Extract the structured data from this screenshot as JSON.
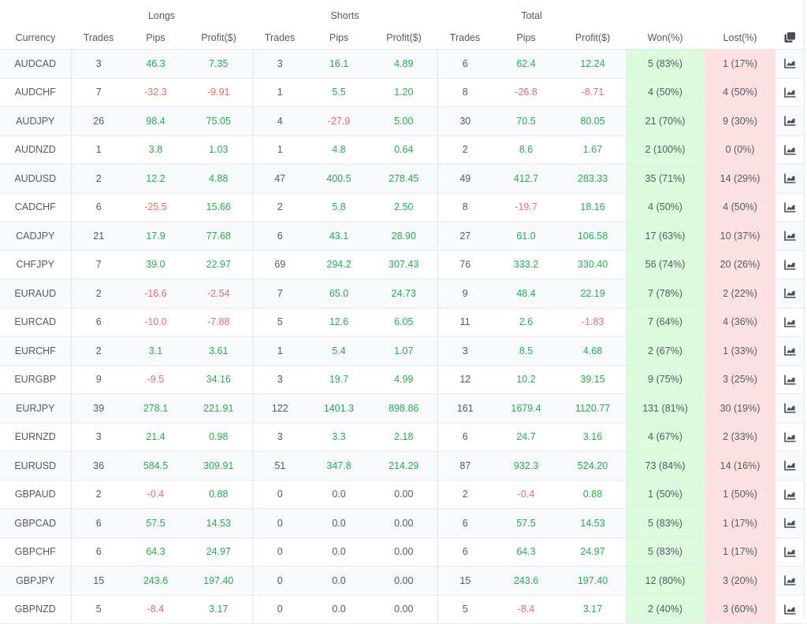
{
  "header": {
    "groups": {
      "longs": "Longs",
      "shorts": "Shorts",
      "total": "Total"
    },
    "columns": {
      "currency": "Currency",
      "long_trades": "Trades",
      "long_pips": "Pips",
      "long_profit": "Profit($)",
      "short_trades": "Trades",
      "short_pips": "Pips",
      "short_profit": "Profit($)",
      "total_trades": "Trades",
      "total_pips": "Pips",
      "total_profit": "Profit($)",
      "won": "Won(%)",
      "lost": "Lost(%)"
    },
    "header_icon": "copy-icon"
  },
  "row_icon": "chart-line-icon",
  "colors": {
    "positive": "#22b14c",
    "negative": "#f0686c",
    "won_bg": "#dcfbdc",
    "lost_bg": "#fde1e2"
  },
  "rows": [
    {
      "currency": "AUDCAD",
      "lt": "3",
      "lp": "46.3",
      "lf": "7.35",
      "st": "3",
      "sp": "16.1",
      "sf": "4.89",
      "tt": "6",
      "tp": "62.4",
      "tf": "12.24",
      "won": "5 (83%)",
      "lost": "1 (17%)"
    },
    {
      "currency": "AUDCHF",
      "lt": "7",
      "lp": "-32.3",
      "lf": "-9.91",
      "st": "1",
      "sp": "5.5",
      "sf": "1.20",
      "tt": "8",
      "tp": "-26.8",
      "tf": "-8.71",
      "won": "4 (50%)",
      "lost": "4 (50%)"
    },
    {
      "currency": "AUDJPY",
      "lt": "26",
      "lp": "98.4",
      "lf": "75.05",
      "st": "4",
      "sp": "-27.9",
      "sf": "5.00",
      "tt": "30",
      "tp": "70.5",
      "tf": "80.05",
      "won": "21 (70%)",
      "lost": "9 (30%)"
    },
    {
      "currency": "AUDNZD",
      "lt": "1",
      "lp": "3.8",
      "lf": "1.03",
      "st": "1",
      "sp": "4.8",
      "sf": "0.64",
      "tt": "2",
      "tp": "8.6",
      "tf": "1.67",
      "won": "2 (100%)",
      "lost": "0 (0%)"
    },
    {
      "currency": "AUDUSD",
      "lt": "2",
      "lp": "12.2",
      "lf": "4.88",
      "st": "47",
      "sp": "400.5",
      "sf": "278.45",
      "tt": "49",
      "tp": "412.7",
      "tf": "283.33",
      "won": "35 (71%)",
      "lost": "14 (29%)"
    },
    {
      "currency": "CADCHF",
      "lt": "6",
      "lp": "-25.5",
      "lf": "15.66",
      "st": "2",
      "sp": "5.8",
      "sf": "2.50",
      "tt": "8",
      "tp": "-19.7",
      "tf": "18.16",
      "won": "4 (50%)",
      "lost": "4 (50%)"
    },
    {
      "currency": "CADJPY",
      "lt": "21",
      "lp": "17.9",
      "lf": "77.68",
      "st": "6",
      "sp": "43.1",
      "sf": "28.90",
      "tt": "27",
      "tp": "61.0",
      "tf": "106.58",
      "won": "17 (63%)",
      "lost": "10 (37%)"
    },
    {
      "currency": "CHFJPY",
      "lt": "7",
      "lp": "39.0",
      "lf": "22.97",
      "st": "69",
      "sp": "294.2",
      "sf": "307.43",
      "tt": "76",
      "tp": "333.2",
      "tf": "330.40",
      "won": "56 (74%)",
      "lost": "20 (26%)"
    },
    {
      "currency": "EURAUD",
      "lt": "2",
      "lp": "-16.6",
      "lf": "-2.54",
      "st": "7",
      "sp": "65.0",
      "sf": "24.73",
      "tt": "9",
      "tp": "48.4",
      "tf": "22.19",
      "won": "7 (78%)",
      "lost": "2 (22%)"
    },
    {
      "currency": "EURCAD",
      "lt": "6",
      "lp": "-10.0",
      "lf": "-7.88",
      "st": "5",
      "sp": "12.6",
      "sf": "6.05",
      "tt": "11",
      "tp": "2.6",
      "tf": "-1.83",
      "won": "7 (64%)",
      "lost": "4 (36%)"
    },
    {
      "currency": "EURCHF",
      "lt": "2",
      "lp": "3.1",
      "lf": "3.61",
      "st": "1",
      "sp": "5.4",
      "sf": "1.07",
      "tt": "3",
      "tp": "8.5",
      "tf": "4.68",
      "won": "2 (67%)",
      "lost": "1 (33%)"
    },
    {
      "currency": "EURGBP",
      "lt": "9",
      "lp": "-9.5",
      "lf": "34.16",
      "st": "3",
      "sp": "19.7",
      "sf": "4.99",
      "tt": "12",
      "tp": "10.2",
      "tf": "39.15",
      "won": "9 (75%)",
      "lost": "3 (25%)"
    },
    {
      "currency": "EURJPY",
      "lt": "39",
      "lp": "278.1",
      "lf": "221.91",
      "st": "122",
      "sp": "1401.3",
      "sf": "898.86",
      "tt": "161",
      "tp": "1679.4",
      "tf": "1120.77",
      "won": "131 (81%)",
      "lost": "30 (19%)"
    },
    {
      "currency": "EURNZD",
      "lt": "3",
      "lp": "21.4",
      "lf": "0.98",
      "st": "3",
      "sp": "3.3",
      "sf": "2.18",
      "tt": "6",
      "tp": "24.7",
      "tf": "3.16",
      "won": "4 (67%)",
      "lost": "2 (33%)"
    },
    {
      "currency": "EURUSD",
      "lt": "36",
      "lp": "584.5",
      "lf": "309.91",
      "st": "51",
      "sp": "347.8",
      "sf": "214.29",
      "tt": "87",
      "tp": "932.3",
      "tf": "524.20",
      "won": "73 (84%)",
      "lost": "14 (16%)"
    },
    {
      "currency": "GBPAUD",
      "lt": "2",
      "lp": "-0.4",
      "lf": "0.88",
      "st": "0",
      "sp": "0.0",
      "sf": "0.00",
      "tt": "2",
      "tp": "-0.4",
      "tf": "0.88",
      "won": "1 (50%)",
      "lost": "1 (50%)"
    },
    {
      "currency": "GBPCAD",
      "lt": "6",
      "lp": "57.5",
      "lf": "14.53",
      "st": "0",
      "sp": "0.0",
      "sf": "0.00",
      "tt": "6",
      "tp": "57.5",
      "tf": "14.53",
      "won": "5 (83%)",
      "lost": "1 (17%)"
    },
    {
      "currency": "GBPCHF",
      "lt": "6",
      "lp": "64.3",
      "lf": "24.97",
      "st": "0",
      "sp": "0.0",
      "sf": "0.00",
      "tt": "6",
      "tp": "64.3",
      "tf": "24.97",
      "won": "5 (83%)",
      "lost": "1 (17%)"
    },
    {
      "currency": "GBPJPY",
      "lt": "15",
      "lp": "243.6",
      "lf": "197.40",
      "st": "0",
      "sp": "0.0",
      "sf": "0.00",
      "tt": "15",
      "tp": "243.6",
      "tf": "197.40",
      "won": "12 (80%)",
      "lost": "3 (20%)"
    },
    {
      "currency": "GBPNZD",
      "lt": "5",
      "lp": "-8.4",
      "lf": "3.17",
      "st": "0",
      "sp": "0.0",
      "sf": "0.00",
      "tt": "5",
      "tp": "-8.4",
      "tf": "3.17",
      "won": "2 (40%)",
      "lost": "3 (60%)"
    }
  ]
}
